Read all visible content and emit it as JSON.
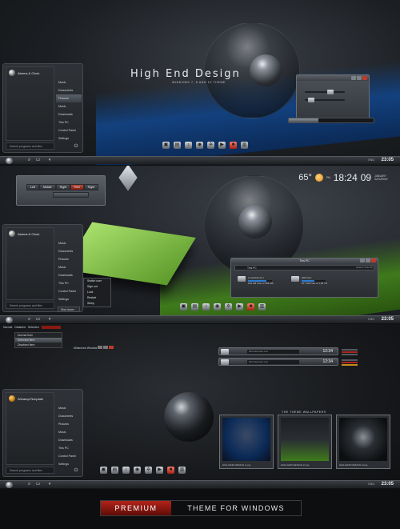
{
  "panel1": {
    "title": "High End Design",
    "subtitle": "WINDOWS 7, 8 AND 10 THEME",
    "start_menu": {
      "user": "Alarms & Clock",
      "items": [
        "Music",
        "Documents",
        "Pictures",
        "Music",
        "Downloads",
        "This PC",
        "Control Panel",
        "Settings"
      ],
      "selected_index": 2,
      "search_placeholder": "Search programs and files"
    },
    "taskbar": {
      "clock": "23:05",
      "tray": "ENG"
    },
    "progress": 0.35
  },
  "panel2": {
    "weather": {
      "temp": "65°",
      "time": "18:24",
      "day": "09",
      "month": "JANUARY",
      "weekday": "SATURDAY",
      "ampm": "PM"
    },
    "segmented": [
      "Left",
      "Middle",
      "Right",
      "Red",
      "Right"
    ],
    "start_menu": {
      "user": "Alarms & Clock",
      "items": [
        "Music",
        "Documents",
        "Pictures",
        "Music",
        "Downloads",
        "This PC",
        "Control Panel",
        "Settings"
      ],
      "search_placeholder": "Search programs and files"
    },
    "shutdown": "Shut down",
    "submenu": [
      "Switch user",
      "Sign out",
      "Lock",
      "Restart",
      "Sleep"
    ],
    "explorer": {
      "title": "This PC",
      "address": "This PC",
      "search": "Search This PC",
      "drives": [
        {
          "name": "Local Disk (C:)",
          "free": "100 GB Free of 465 GB",
          "used": 0.78
        },
        {
          "name": "HDD (D:)",
          "free": "877 GB Free of 1,80 TB",
          "used": 0.52
        }
      ]
    },
    "taskbar": {
      "clock": "23:05",
      "tray": "ENG"
    }
  },
  "panel3": {
    "menubar": [
      "Normal",
      "Disabled",
      "Selected"
    ],
    "list": [
      "Normal Item",
      "Selected Item",
      "Disabled Item"
    ],
    "minimized": "Minimized Window",
    "start_menu": {
      "user": "Winamp/Template",
      "items": [
        "Music",
        "Documents",
        "Pictures",
        "Music",
        "Downloads",
        "This PC",
        "Control Panel",
        "Settings"
      ],
      "search_placeholder": "Search programs and files"
    },
    "music": [
      {
        "label": "WinCustomize.com",
        "time": "12:34"
      },
      {
        "label": "WinCustomize.com",
        "time": "12:34"
      }
    ],
    "wallpaper_title": "THE THEME WALLPAPERS",
    "thumbs": [
      "HIGH END DESIGN 1.png",
      "HIGH END DESIGN 2.png",
      "HIGH END DESIGN 3.png"
    ],
    "taskbar": {
      "clock": "23:05",
      "tray": "ENG"
    }
  },
  "banner": {
    "left": "PREMIUM",
    "right": "THEME FOR WINDOWS"
  },
  "colors": {
    "accent_red": "#b3231a",
    "blue": "#13417e",
    "green": "#3f7a1c"
  }
}
